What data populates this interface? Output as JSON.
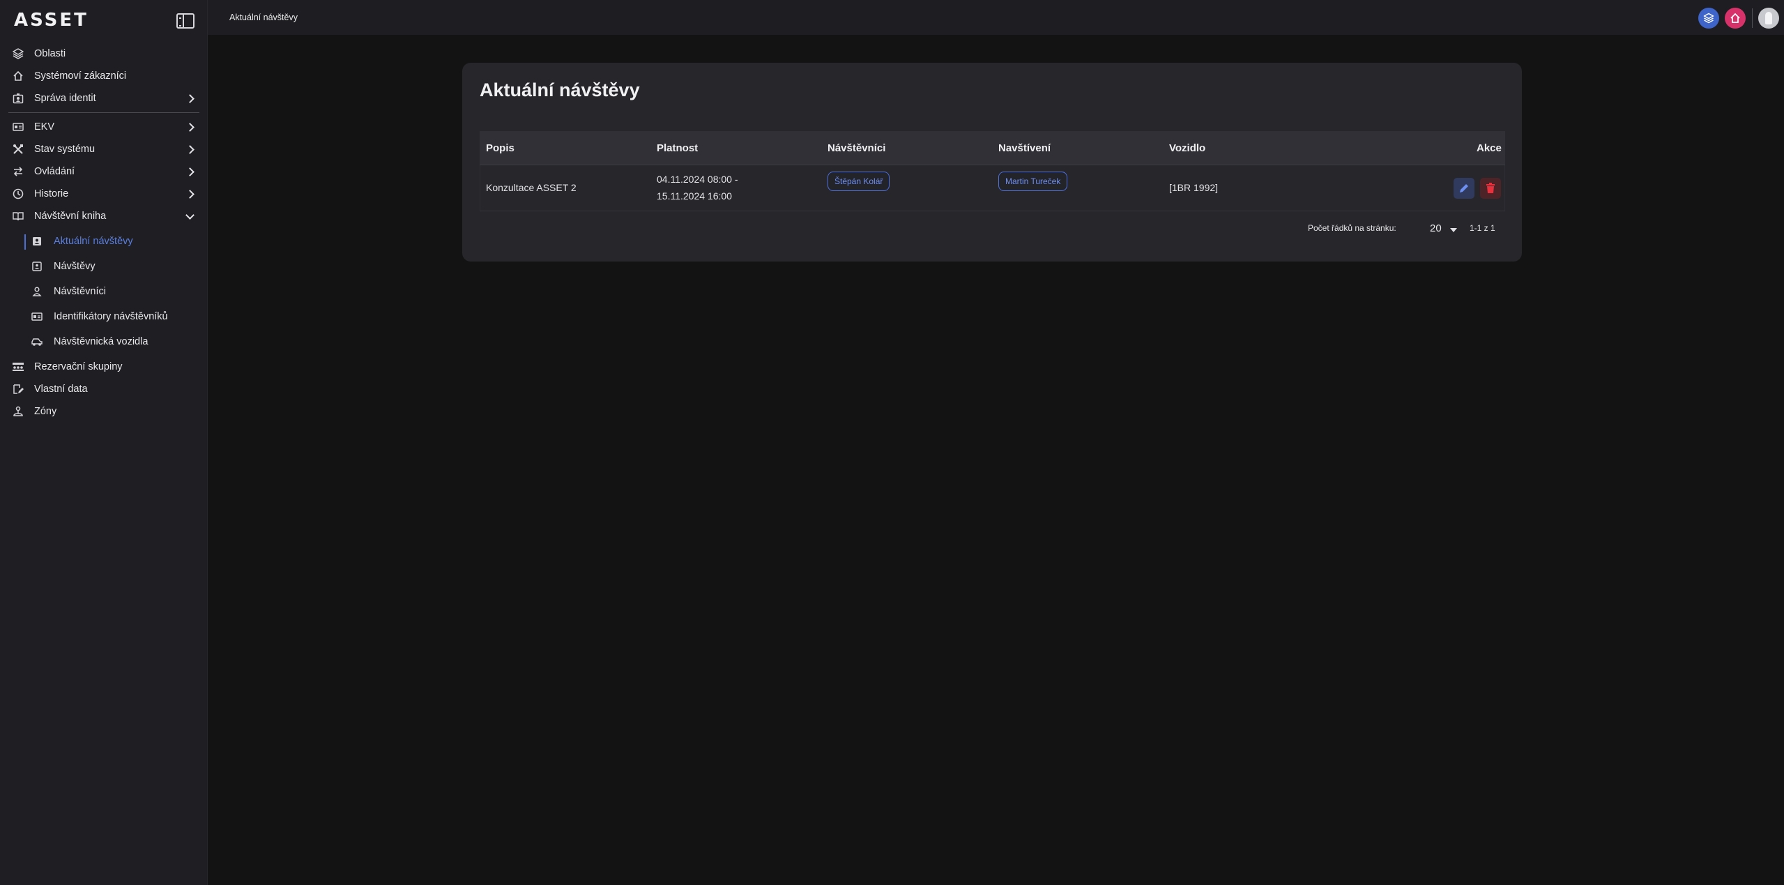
{
  "app": {
    "logo": "ASSET"
  },
  "topbar": {
    "breadcrumb": "Aktuální návštěvy"
  },
  "sidebar": {
    "items": [
      {
        "label": "Oblasti",
        "icon": "layers-icon"
      },
      {
        "label": "Systémoví zákazníci",
        "icon": "home-icon"
      },
      {
        "label": "Správa identit",
        "icon": "id-badge-icon",
        "expandable": true
      },
      {
        "label": "EKV",
        "icon": "id-card-icon",
        "expandable": true
      },
      {
        "label": "Stav systému",
        "icon": "tools-icon",
        "expandable": true
      },
      {
        "label": "Ovládání",
        "icon": "swap-icon",
        "expandable": true
      },
      {
        "label": "Historie",
        "icon": "clock-icon",
        "expandable": true
      },
      {
        "label": "Návštěvní kniha",
        "icon": "book-icon",
        "expanded": true
      }
    ],
    "sub_items": [
      {
        "label": "Aktuální návštěvy",
        "icon": "contact-card-icon",
        "active": true
      },
      {
        "label": "Návštěvy",
        "icon": "contact-card-outline-icon"
      },
      {
        "label": "Návštěvníci",
        "icon": "person-icon"
      },
      {
        "label": "Identifikátory návštěvníků",
        "icon": "id-card-icon"
      },
      {
        "label": "Návštěvnická vozidla",
        "icon": "car-icon"
      }
    ],
    "bottom_items": [
      {
        "label": "Rezervační skupiny",
        "icon": "group-icon"
      },
      {
        "label": "Vlastní data",
        "icon": "edit-note-icon"
      },
      {
        "label": "Zóny",
        "icon": "map-marker-icon"
      }
    ]
  },
  "main": {
    "title": "Aktuální návštěvy",
    "columns": [
      "Popis",
      "Platnost",
      "Návštěvníci",
      "Navštívení",
      "Vozidlo",
      "Akce"
    ],
    "rows": [
      {
        "popis": "Konzultace ASSET 2",
        "platnost_from": "04.11.2024 08:00 -",
        "platnost_to": "15.11.2024 16:00",
        "navstevnici": "Štěpán Kolář",
        "navstiveni": "Martin Tureček",
        "vozidlo": "[1BR 1992]"
      }
    ],
    "pager": {
      "rows_label": "Počet řádků na stránku:",
      "rows_per_page": "20",
      "range": "1-1 z 1"
    }
  },
  "colors": {
    "accent": "#4b6fd6",
    "danger": "#e8313d",
    "brand_pink": "#d8326a"
  }
}
